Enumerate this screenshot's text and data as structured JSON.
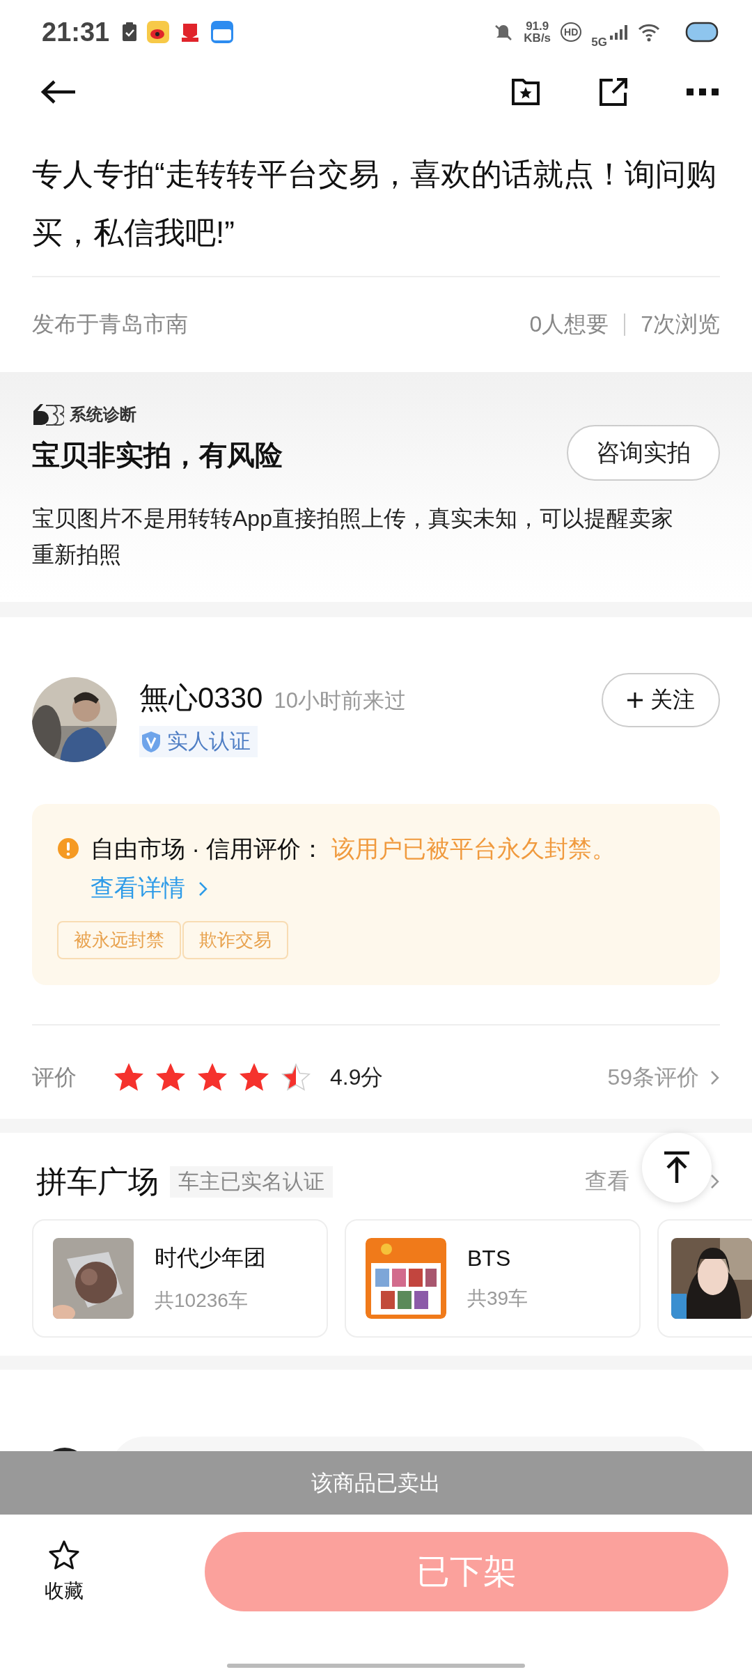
{
  "status_bar": {
    "time": "21:31",
    "net_speed": "91.9",
    "net_unit": "KB/s",
    "hd": "HD",
    "network": "5G"
  },
  "description": "专人专拍“走转转平台交易，喜欢的话就点！询问购买，私信我吧!”",
  "location": "发布于青岛市南",
  "wants": "0人想要",
  "views": "7次浏览",
  "diagnosis": {
    "label": "系统诊断",
    "title": "宝贝非实拍，有风险",
    "body": "宝贝图片不是用转转App直接拍照上传，真实未知，可以提醒卖家重新拍照",
    "button": "咨询实拍"
  },
  "seller": {
    "name": "無心0330",
    "last_seen": "10小时前来过",
    "verify_label": "实人认证",
    "follow": "关注"
  },
  "credit": {
    "prefix": "自由市场 · 信用评价：",
    "status": "该用户已被平台永久封禁。",
    "link": "查看详情",
    "tags": [
      "被永远封禁",
      "欺诈交易"
    ]
  },
  "rating": {
    "label": "评价",
    "stars": 4.5,
    "score": "4.9分",
    "count": "59条评价"
  },
  "carpool": {
    "title": "拼车广场",
    "badge": "车主已实名认证",
    "more": "查看",
    "cards": [
      {
        "kind": "group",
        "name": "时代少年团",
        "count": "共10236车"
      },
      {
        "kind": "group",
        "name": "BTS",
        "count": "共39车"
      },
      {
        "kind": "picture"
      }
    ]
  },
  "toast": "该商品已卖出",
  "bottom": {
    "favorite": "收藏",
    "favorited": false,
    "action": "已下架"
  }
}
